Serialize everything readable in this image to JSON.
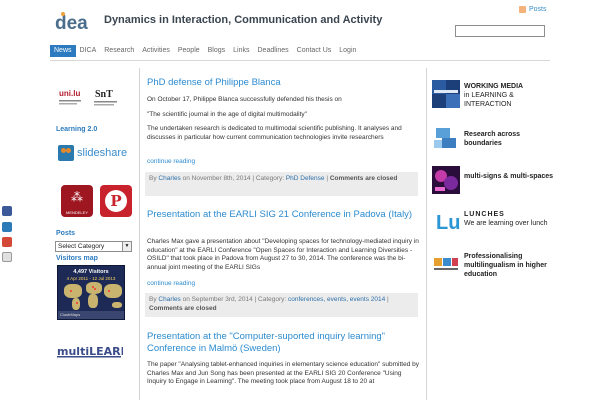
{
  "header": {
    "logo_text": "dea",
    "title": "Dynamics in Interaction, Communication and Activity",
    "rss_label": "Posts"
  },
  "nav": {
    "items": [
      "News",
      "DICA",
      "Research",
      "Activities",
      "People",
      "Blogs",
      "Links",
      "Deadlines",
      "Contact Us",
      "Login"
    ]
  },
  "left_sidebar": {
    "uni_logo_text": "uni.lu",
    "snt_logo_text": "SnT",
    "learning_heading": "Learning 2.0",
    "slideshare_label": "slideshare",
    "mendeley_label": "MENDELEY",
    "posts_heading": "Posts",
    "category_select": "Select Category",
    "visitors_heading": "Visitors map",
    "visitors_count": "4,497 Visitors",
    "visitors_dates": "4 Apr 2011 - 12 Jul 2013",
    "map_footer": "ClustrMaps",
    "multilearn_label": "multiLEARN"
  },
  "posts": [
    {
      "title": "PhD defense of Philippe Blanca",
      "paragraphs": [
        "On October 17, Philippe Blanca successfully defended his thesis on",
        "\"The scientific journal in the age of digital multimodality\"",
        "The undertaken research is dedicated to multimodal scientific publishing. It analyses and discusses in particular how current communication technologies invite researchers"
      ],
      "continue": "continue reading",
      "meta_by": "By ",
      "author": "Charles",
      "meta_date": " on November 8th, 2014 | Category: ",
      "category": "PhD Defense",
      "comments": "Comments are closed"
    },
    {
      "title": "Presentation at the EARLI SIG 21 Conference in Padova (Italy)",
      "paragraphs": [
        "Charles Max gave a presentation about  \"Developing spaces for technology-mediated inquiry in education\" at the EARLI Conference \"Open Spaces for Interaction and Learning Diversities - OSILD\" that took place in Padova from August 27 to 30, 2014. The conference was the bi-annual joint meeting of the  EARLI SIGs"
      ],
      "continue": "continue reading",
      "meta_by": "By ",
      "author": "Charles",
      "meta_date": " on September 3rd, 2014 | Category: ",
      "category": "conferences, events, events 2014",
      "comments": "Comments are closed"
    },
    {
      "title": "Presentation at the \"Computer-suported inquiry learning\" Conference in Malmö (Sweden)",
      "paragraphs": [
        "The paper \"Analysing tablet-enhanced inquiries in elementary science education\" submitted by Charles Max and Jun Song has been presented at the EARLI SIG 20 Conference  \"Using Inquiry to Engage in Learning\". The meeting took place  from August 18 to 20 at"
      ]
    }
  ],
  "right_sidebar": {
    "items": [
      {
        "bold": "WORKING MEDIA",
        "text": "in LEARNING & INTERACTION"
      },
      {
        "bold": "Research across boundaries",
        "text": ""
      },
      {
        "bold": "multi-signs & multi-spaces",
        "text": ""
      },
      {
        "bold": "LUNCHES",
        "text": "We are learning over lunch"
      },
      {
        "bold": "Professionalising multilingualism in higher education",
        "text": ""
      }
    ],
    "lu_logo": "Lu"
  },
  "colors": {
    "accent": "#2c8bcf",
    "nav_active": "#2c7bc0",
    "meta_bg": "#ececec"
  }
}
